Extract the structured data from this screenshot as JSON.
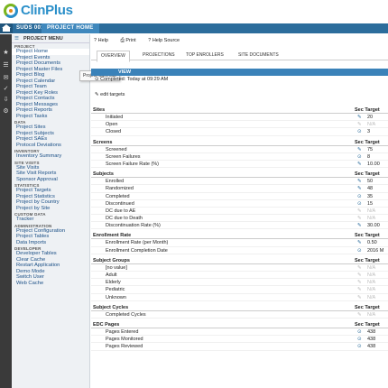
{
  "app": {
    "title": "ClinPlus"
  },
  "nav": {
    "study": "SUDS 001",
    "project": "PROJECT HOME"
  },
  "menu": {
    "header": "PROJECT MENU",
    "sections": [
      {
        "title": "PROJECT",
        "items": [
          "Project Home",
          "Project Events",
          "Project Documents",
          "Project Master Files",
          "Project Blog",
          "Project Calendar",
          "Project Team",
          "Project Key Roles",
          "Project Contacts",
          "Project Messages",
          "Project Reports",
          "Project Tasks"
        ]
      },
      {
        "title": "DATA",
        "items": [
          "Project Sites",
          "Project Subjects",
          "Project SAEs",
          "Protocol Deviations"
        ]
      },
      {
        "title": "INVENTORY",
        "items": [
          "Inventory Summary"
        ]
      },
      {
        "title": "SITE VISITS",
        "items": [
          "Site Visits",
          "Site Visit Reports",
          "Sponsor Approval"
        ]
      },
      {
        "title": "STATISTICS",
        "items": [
          "Project Targets",
          "Project Statistics",
          "Project by Country",
          "Project by Site"
        ]
      },
      {
        "title": "CUSTOM DATA",
        "items": [
          "Tracker"
        ]
      },
      {
        "title": "ADMINISTRATION",
        "items": [
          "Project Configuration",
          "Project Tables",
          "Data Imports"
        ]
      },
      {
        "title": "DEVELOPER",
        "items": [
          "Developer Tables",
          "Clear Cache",
          "Restart Application",
          "Demo Mode",
          "Switch User",
          "Web Cache"
        ]
      }
    ]
  },
  "tooltip": "Project Calendar",
  "toolbar": {
    "help": "Help",
    "print": "Print",
    "help_source": "Help Source"
  },
  "tabs": [
    "OVERVIEW",
    "PROJECTIONS",
    "TOP ENROLLERS",
    "SITE DOCUMENTS"
  ],
  "overview": {
    "bar_label": "VIEW",
    "completed": "Completed: Today at 09:29 AM",
    "edit": "edit targets",
    "sec_target_label": "Sec Target"
  },
  "groups": [
    {
      "title": "Sites",
      "rows": [
        {
          "label": "Initiated",
          "icon": "target",
          "value": "20"
        },
        {
          "label": "Open",
          "icon": "off",
          "value": "N/A"
        },
        {
          "label": "Closed",
          "icon": "circle",
          "value": "3"
        }
      ]
    },
    {
      "title": "Screens",
      "rows": [
        {
          "label": "Screened",
          "icon": "target",
          "value": "75"
        },
        {
          "label": "Screen Failures",
          "icon": "circle",
          "value": "8"
        },
        {
          "label": "Screen Failure Rate (%)",
          "icon": "target",
          "value": "10.00"
        }
      ]
    },
    {
      "title": "Subjects",
      "rows": [
        {
          "label": "Enrolled",
          "icon": "target",
          "value": "50"
        },
        {
          "label": "Randomized",
          "icon": "target",
          "value": "48"
        },
        {
          "label": "Completed",
          "icon": "circle",
          "value": "35"
        },
        {
          "label": "Discontinued",
          "icon": "circle",
          "value": "15"
        },
        {
          "label": "DC due to AE",
          "icon": "off",
          "value": "N/A"
        },
        {
          "label": "DC due to Death",
          "icon": "off",
          "value": "N/A"
        },
        {
          "label": "Discontinuation Rate (%)",
          "icon": "target",
          "value": "30.00"
        }
      ]
    },
    {
      "title": "Enrollment Rate",
      "rows": [
        {
          "label": "Enrollment Rate (per Month)",
          "icon": "target",
          "value": "0.50"
        },
        {
          "label": "Enrollment Completion Date",
          "icon": "circle",
          "value": "2016 M"
        }
      ]
    },
    {
      "title": "Subject Groups",
      "rows": [
        {
          "label": "[no value]",
          "icon": "off",
          "value": "N/A"
        },
        {
          "label": "Adult",
          "icon": "off",
          "value": "N/A"
        },
        {
          "label": "Elderly",
          "icon": "off",
          "value": "N/A"
        },
        {
          "label": "Pediatric",
          "icon": "off",
          "value": "N/A"
        },
        {
          "label": "Unknown",
          "icon": "off",
          "value": "N/A"
        }
      ]
    },
    {
      "title": "Subject Cycles",
      "rows": [
        {
          "label": "Completed Cycles",
          "icon": "off",
          "value": "N/A"
        }
      ]
    },
    {
      "title": "EDC Pages",
      "rows": [
        {
          "label": "Pages Entered",
          "icon": "circle",
          "value": "438"
        },
        {
          "label": "Pages Monitored",
          "icon": "circle",
          "value": "438"
        },
        {
          "label": "Pages Reviewed",
          "icon": "circle",
          "value": "438"
        }
      ]
    }
  ],
  "colors": {
    "nav": "#2c6d9c",
    "accent": "#3a82b9",
    "brand_blue": "#2a8fc9",
    "brand_green": "#7ab51d"
  }
}
